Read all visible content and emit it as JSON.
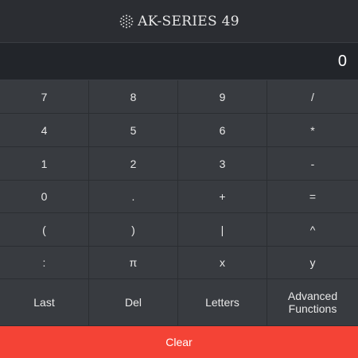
{
  "header": {
    "title": "AK-SERIES 49",
    "logo_icon": "dotted-globe-icon"
  },
  "display": {
    "value": "0"
  },
  "keys": [
    {
      "label": "7",
      "name": "key-7"
    },
    {
      "label": "8",
      "name": "key-8"
    },
    {
      "label": "9",
      "name": "key-9"
    },
    {
      "label": "/",
      "name": "key-divide"
    },
    {
      "label": "4",
      "name": "key-4"
    },
    {
      "label": "5",
      "name": "key-5"
    },
    {
      "label": "6",
      "name": "key-6"
    },
    {
      "label": "*",
      "name": "key-multiply"
    },
    {
      "label": "1",
      "name": "key-1"
    },
    {
      "label": "2",
      "name": "key-2"
    },
    {
      "label": "3",
      "name": "key-3"
    },
    {
      "label": "-",
      "name": "key-minus"
    },
    {
      "label": "0",
      "name": "key-0"
    },
    {
      "label": ".",
      "name": "key-decimal"
    },
    {
      "label": "+",
      "name": "key-plus"
    },
    {
      "label": "=",
      "name": "key-equals"
    },
    {
      "label": "(",
      "name": "key-open-paren"
    },
    {
      "label": ")",
      "name": "key-close-paren"
    },
    {
      "label": "|",
      "name": "key-pipe"
    },
    {
      "label": "^",
      "name": "key-power"
    },
    {
      "label": ":",
      "name": "key-colon"
    },
    {
      "label": "π",
      "name": "key-pi"
    },
    {
      "label": "x",
      "name": "key-x"
    },
    {
      "label": "y",
      "name": "key-y"
    },
    {
      "label": "Last",
      "name": "last-button"
    },
    {
      "label": "Del",
      "name": "delete-button"
    },
    {
      "label": "Letters",
      "name": "letters-button"
    },
    {
      "label": "Advanced Functions",
      "name": "advanced-functions-button"
    }
  ],
  "clear_label": "Clear",
  "colors": {
    "header_bg": "#2b2d32",
    "display_bg": "#22252a",
    "key_bg": "#383b40",
    "clear_bg": "#f44336"
  }
}
